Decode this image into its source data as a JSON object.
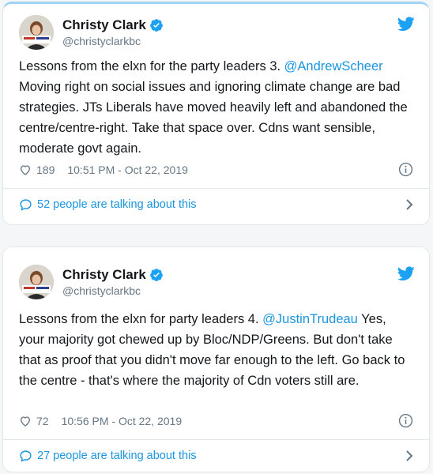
{
  "colors": {
    "link": "#1b95e0",
    "text": "#14171a",
    "muted": "#657786",
    "verified": "#1da1f2",
    "border": "#e1e8ed"
  },
  "tweets": [
    {
      "author": {
        "name": "Christy Clark",
        "handle": "@christyclarkbc",
        "verified_icon": "verified-badge-icon"
      },
      "platform_icon": "twitter-bird-icon",
      "text_before": "Lessons from the elxn for the party leaders 3. ",
      "mention": "@AndrewScheer",
      "text_after": " Moving right on social issues and ignoring climate change are bad strategies.  JTs Liberals have moved heavily left and abandoned the centre/centre-right. Take that space over. Cdns want sensible, moderate govt again.",
      "likes": "189",
      "timestamp": "10:51 PM - Oct 22, 2019",
      "talking": "52 people are talking about this"
    },
    {
      "author": {
        "name": "Christy Clark",
        "handle": "@christyclarkbc",
        "verified_icon": "verified-badge-icon"
      },
      "platform_icon": "twitter-bird-icon",
      "text_before": "Lessons from the elxn for party leaders 4. ",
      "mention": "@JustinTrudeau",
      "text_after": " Yes, your majority got chewed up by Bloc/NDP/Greens. But don't take that as proof that you didn't move far enough to the left.  Go back to the centre - that's where the majority of Cdn voters still are.",
      "likes": "72",
      "timestamp": "10:56 PM - Oct 22, 2019",
      "talking": "27 people are talking about this"
    }
  ]
}
